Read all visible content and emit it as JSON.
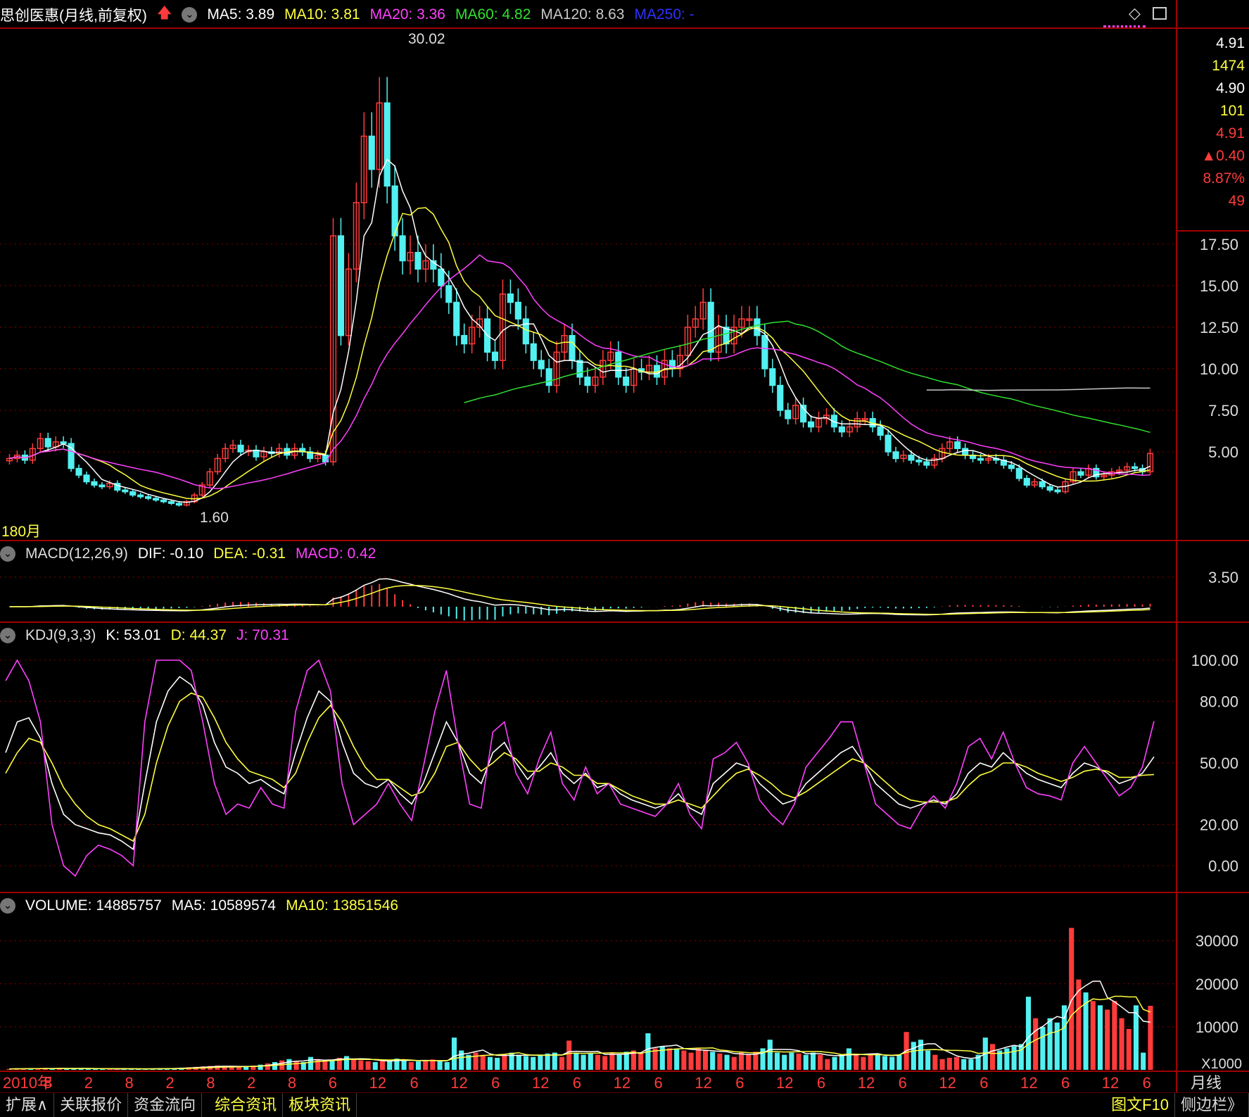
{
  "colors": {
    "up": "#ff3b3b",
    "down": "#52f0f0",
    "ma5": "#ffffff",
    "ma10": "#ffff40",
    "ma20": "#ff40ff",
    "ma60": "#30e030",
    "ma120": "#c8c8c8",
    "ma250": "#3030ff",
    "grid": "#8a0000"
  },
  "header": {
    "stock": "思创医惠(月线,前复权)",
    "ma5": "MA5: 3.89",
    "ma10": "MA10: 3.81",
    "ma20": "MA20: 3.36",
    "ma60": "MA60: 4.82",
    "ma120": "MA120: 8.63",
    "ma250": "MA250: -"
  },
  "side_info": [
    "4.91",
    "1474",
    "4.90",
    "101",
    "4.91",
    "▲0.40",
    "8.87%",
    "49"
  ],
  "price_annotations": {
    "high": "30.02",
    "low": "1.60",
    "period": "180月"
  },
  "macd_header": {
    "name": "MACD(12,26,9)",
    "dif": "DIF: -0.10",
    "dea": "DEA: -0.31",
    "macd": "MACD: 0.42"
  },
  "kdj_header": {
    "name": "KDJ(9,3,3)",
    "k": "K: 53.01",
    "d": "D: 44.37",
    "j": "J: 70.31"
  },
  "vol_header": {
    "name": "VOLUME: 14885757",
    "ma5": "MA5: 10589574",
    "ma10": "MA10: 13851546"
  },
  "x_axis": {
    "labels": [
      "2010年",
      "8",
      "2",
      "8",
      "2",
      "8",
      "2",
      "8",
      "6",
      "12",
      "6",
      "12",
      "6",
      "12",
      "6",
      "12",
      "6",
      "12",
      "6",
      "12",
      "6",
      "12",
      "6",
      "12",
      "6",
      "12",
      "6",
      "12",
      "6"
    ],
    "right": "月线"
  },
  "tabs": [
    "扩展∧",
    "关联报价",
    "资金流向",
    "综合资讯",
    "板块资讯"
  ],
  "right_tabs": [
    "图文F10",
    "侧边栏》"
  ],
  "chart_data": [
    {
      "type": "candlestick",
      "title": "思创医惠(月线,前复权)",
      "y_ticks": [
        "17.50",
        "15.00",
        "12.50",
        "10.00",
        "7.50",
        "5.00"
      ],
      "close": [
        4.6,
        4.8,
        4.5,
        5.2,
        5.8,
        5.3,
        5.6,
        5.5,
        4.0,
        3.6,
        3.2,
        3.0,
        2.9,
        3.1,
        2.7,
        2.6,
        2.4,
        2.3,
        2.2,
        2.1,
        2.0,
        1.9,
        1.8,
        2.0,
        2.4,
        3.0,
        3.8,
        4.6,
        5.2,
        5.4,
        5.0,
        5.1,
        4.7,
        5.0,
        4.9,
        5.2,
        4.8,
        5.2,
        5.0,
        4.6,
        4.8,
        4.4,
        18.0,
        12.0,
        16.0,
        20.0,
        24.0,
        22.0,
        26.0,
        21.0,
        18.0,
        16.5,
        17.0,
        16.0,
        16.5,
        16.0,
        15.0,
        14.0,
        12.0,
        11.5,
        12.5,
        13.0,
        11.0,
        10.5,
        14.5,
        14.0,
        13.0,
        11.5,
        10.5,
        10.0,
        9.0,
        11.0,
        12.0,
        10.5,
        9.5,
        9.0,
        9.5,
        10.5,
        11.0,
        9.5,
        9.0,
        10.0,
        9.8,
        10.2,
        9.5,
        10.5,
        10.0,
        10.8,
        12.5,
        13.0,
        14.0,
        11.0,
        12.5,
        11.5,
        12.5,
        13.0,
        13.0,
        12.0,
        10.0,
        9.0,
        7.5,
        7.0,
        7.8,
        6.8,
        6.5,
        7.0,
        7.2,
        6.5,
        6.2,
        6.5,
        7.0,
        7.0,
        6.5,
        6.0,
        5.0,
        4.6,
        4.8,
        4.5,
        4.4,
        4.2,
        4.6,
        5.2,
        5.6,
        5.2,
        4.8,
        4.6,
        4.5,
        4.6,
        4.5,
        4.2,
        4.0,
        3.4,
        3.0,
        3.2,
        2.9,
        2.7,
        2.6,
        3.2,
        3.8,
        3.6,
        4.0,
        3.5,
        3.6,
        3.8,
        3.9,
        4.1,
        4.0,
        3.8,
        4.9
      ],
      "ma_levels": {
        "ma5": 3.89,
        "ma10": 3.81,
        "ma20": 3.36,
        "ma60": 4.82,
        "ma120": 8.63
      }
    },
    {
      "type": "bar",
      "title": "MACD(12,26,9)",
      "y_ticks": [
        "3.50"
      ],
      "dif": -0.1,
      "dea": -0.31,
      "macd": 0.42
    },
    {
      "type": "line",
      "title": "KDJ(9,3,3)",
      "y_ticks": [
        "100.00",
        "80.00",
        "50.00",
        "20.00",
        "0.00"
      ],
      "series": [
        {
          "name": "K",
          "values": [
            55,
            70,
            72,
            62,
            40,
            25,
            20,
            18,
            16,
            15,
            12,
            8,
            40,
            70,
            85,
            92,
            88,
            78,
            60,
            48,
            45,
            40,
            42,
            38,
            35,
            55,
            72,
            85,
            80,
            60,
            45,
            40,
            38,
            42,
            35,
            30,
            40,
            55,
            70,
            60,
            45,
            40,
            55,
            60,
            50,
            42,
            48,
            55,
            45,
            40,
            45,
            38,
            40,
            35,
            32,
            30,
            28,
            30,
            35,
            28,
            25,
            40,
            45,
            50,
            48,
            40,
            35,
            30,
            32,
            40,
            45,
            50,
            55,
            58,
            50,
            40,
            35,
            30,
            28,
            30,
            32,
            30,
            35,
            45,
            50,
            48,
            55,
            50,
            45,
            42,
            40,
            38,
            45,
            50,
            48,
            45,
            40,
            42,
            45,
            53
          ]
        },
        {
          "name": "D",
          "values": [
            45,
            55,
            62,
            60,
            50,
            38,
            30,
            24,
            20,
            18,
            15,
            12,
            25,
            50,
            68,
            80,
            84,
            82,
            72,
            60,
            52,
            46,
            44,
            42,
            38,
            45,
            60,
            72,
            78,
            70,
            58,
            48,
            42,
            42,
            38,
            34,
            36,
            45,
            58,
            60,
            52,
            46,
            50,
            55,
            52,
            46,
            46,
            50,
            48,
            44,
            44,
            40,
            40,
            37,
            34,
            32,
            30,
            30,
            32,
            30,
            28,
            34,
            40,
            45,
            47,
            44,
            40,
            35,
            33,
            36,
            40,
            44,
            48,
            52,
            50,
            45,
            40,
            35,
            32,
            31,
            31,
            31,
            33,
            39,
            44,
            46,
            50,
            50,
            48,
            45,
            43,
            41,
            43,
            46,
            47,
            46,
            43,
            43,
            44,
            44.37
          ]
        },
        {
          "name": "J",
          "values": [
            90,
            100,
            90,
            70,
            20,
            0,
            -5,
            5,
            10,
            8,
            5,
            0,
            70,
            100,
            100,
            100,
            95,
            70,
            40,
            25,
            30,
            28,
            38,
            30,
            28,
            75,
            95,
            100,
            85,
            40,
            20,
            25,
            30,
            40,
            30,
            22,
            48,
            75,
            95,
            60,
            30,
            28,
            65,
            70,
            45,
            35,
            52,
            65,
            40,
            32,
            48,
            35,
            40,
            30,
            28,
            26,
            24,
            30,
            40,
            25,
            18,
            52,
            55,
            60,
            50,
            32,
            25,
            20,
            30,
            48,
            55,
            62,
            70,
            70,
            50,
            30,
            25,
            20,
            18,
            28,
            34,
            28,
            40,
            58,
            62,
            52,
            65,
            50,
            38,
            35,
            34,
            32,
            50,
            58,
            50,
            42,
            34,
            38,
            48,
            70.31
          ]
        }
      ]
    },
    {
      "type": "bar",
      "title": "VOLUME",
      "y_ticks": [
        "30000",
        "20000",
        "10000"
      ],
      "unit": "X1000",
      "values": [
        200,
        300,
        250,
        400,
        350,
        300,
        250,
        400,
        350,
        300,
        300,
        250,
        200,
        250,
        200,
        200,
        300,
        250,
        200,
        200,
        300,
        350,
        300,
        400,
        500,
        600,
        700,
        800,
        900,
        1000,
        800,
        700,
        600,
        900,
        1000,
        1200,
        1500,
        1800,
        2200,
        2500,
        2000,
        1800,
        3000,
        2500,
        2000,
        2200,
        2800,
        3200,
        2500,
        2200,
        2000,
        1800,
        2200,
        2000,
        2600,
        2400,
        1800,
        2000,
        2200,
        2400,
        2000,
        1800,
        7500,
        4500,
        3500,
        4000,
        3500,
        3000,
        2800,
        3500,
        4000,
        3500,
        3200,
        3000,
        3500,
        3800,
        4000,
        3000,
        6800,
        4000,
        3500,
        3800,
        3500,
        3200,
        4000,
        3500,
        4200,
        4500,
        3800,
        8500,
        5000,
        5500,
        5000,
        4800,
        4500,
        4000,
        5000,
        4500,
        4200,
        3800,
        3500,
        3000,
        4000,
        3500,
        4200,
        5000,
        7000,
        4000,
        3500,
        4000,
        3800,
        3500,
        4000,
        3500,
        2500,
        3000,
        3500,
        5000,
        3500,
        3000,
        3500,
        3800,
        3200,
        3000,
        3500,
        8800,
        6500,
        7000,
        4500,
        3500,
        2500,
        2800,
        3000,
        2500,
        2500,
        3500,
        7500,
        6000,
        4500,
        5000,
        5500,
        6000,
        17000,
        12000,
        10000,
        12000,
        11000,
        15000,
        33000,
        21000,
        18000,
        16000,
        15000,
        14000,
        16000,
        12000,
        9500,
        15000,
        4000,
        14886
      ]
    }
  ]
}
